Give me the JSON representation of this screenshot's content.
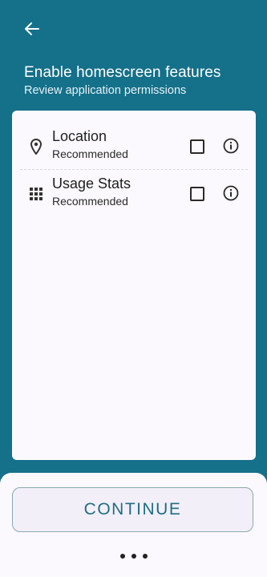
{
  "header": {
    "back_icon": "arrow-left-icon",
    "title": "Enable homescreen features",
    "subtitle": "Review application permissions"
  },
  "permissions": [
    {
      "icon": "location-pin-icon",
      "title": "Location",
      "subtitle": "Recommended",
      "checked": false,
      "info_icon": "info-icon"
    },
    {
      "icon": "grid-apps-icon",
      "title": "Usage Stats",
      "subtitle": "Recommended",
      "checked": false,
      "info_icon": "info-icon"
    }
  ],
  "footer": {
    "continue_label": "CONTINUE",
    "page_indicator_icon": "more-dots-icon"
  },
  "colors": {
    "background": "#15708a",
    "card": "#fbf9fd",
    "accent_text": "#1e6f86"
  }
}
